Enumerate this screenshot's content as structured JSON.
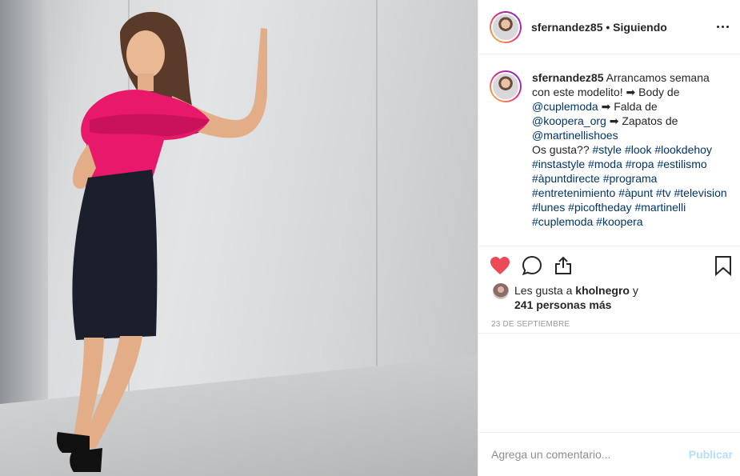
{
  "post": {
    "username": "sfernandez85",
    "follow_state": "Siguiendo",
    "separator": "•"
  },
  "caption": {
    "username": "sfernandez85",
    "line1": "Arrancamos semana con este modelito! ➡ Body de",
    "mention1": "@cuplemoda",
    "text2": "➡ Falda de",
    "mention2": "@koopera_org",
    "text3": "➡ Zapatos de",
    "mention3": "@martinellishoes",
    "text4": "Os gusta??",
    "hashtags": [
      "#style",
      "#look",
      "#lookdehoy",
      "#instastyle",
      "#moda",
      "#ropa",
      "#estilismo",
      "#àpuntdirecte",
      "#programa",
      "#entretenimiento",
      "#àpunt",
      "#tv",
      "#television",
      "#lunes",
      "#picoftheday",
      "#martinelli",
      "#cuplemoda",
      "#koopera"
    ]
  },
  "likes": {
    "prefix": "Les gusta a",
    "user": "kholnegro",
    "conj": "y",
    "others": "241 personas más"
  },
  "date": "23 DE SEPTIEMBRE",
  "comment": {
    "placeholder": "Agrega un comentario...",
    "post_label": "Publicar"
  },
  "colors": {
    "like_red": "#ed4956",
    "link_blue": "#003569",
    "publish_disabled": "#b2dffc",
    "top_pink": "#e8196b",
    "skirt": "#1a1f2b"
  },
  "icons": [
    "more-options-icon",
    "heart-icon",
    "comment-icon",
    "share-icon",
    "bookmark-icon"
  ]
}
